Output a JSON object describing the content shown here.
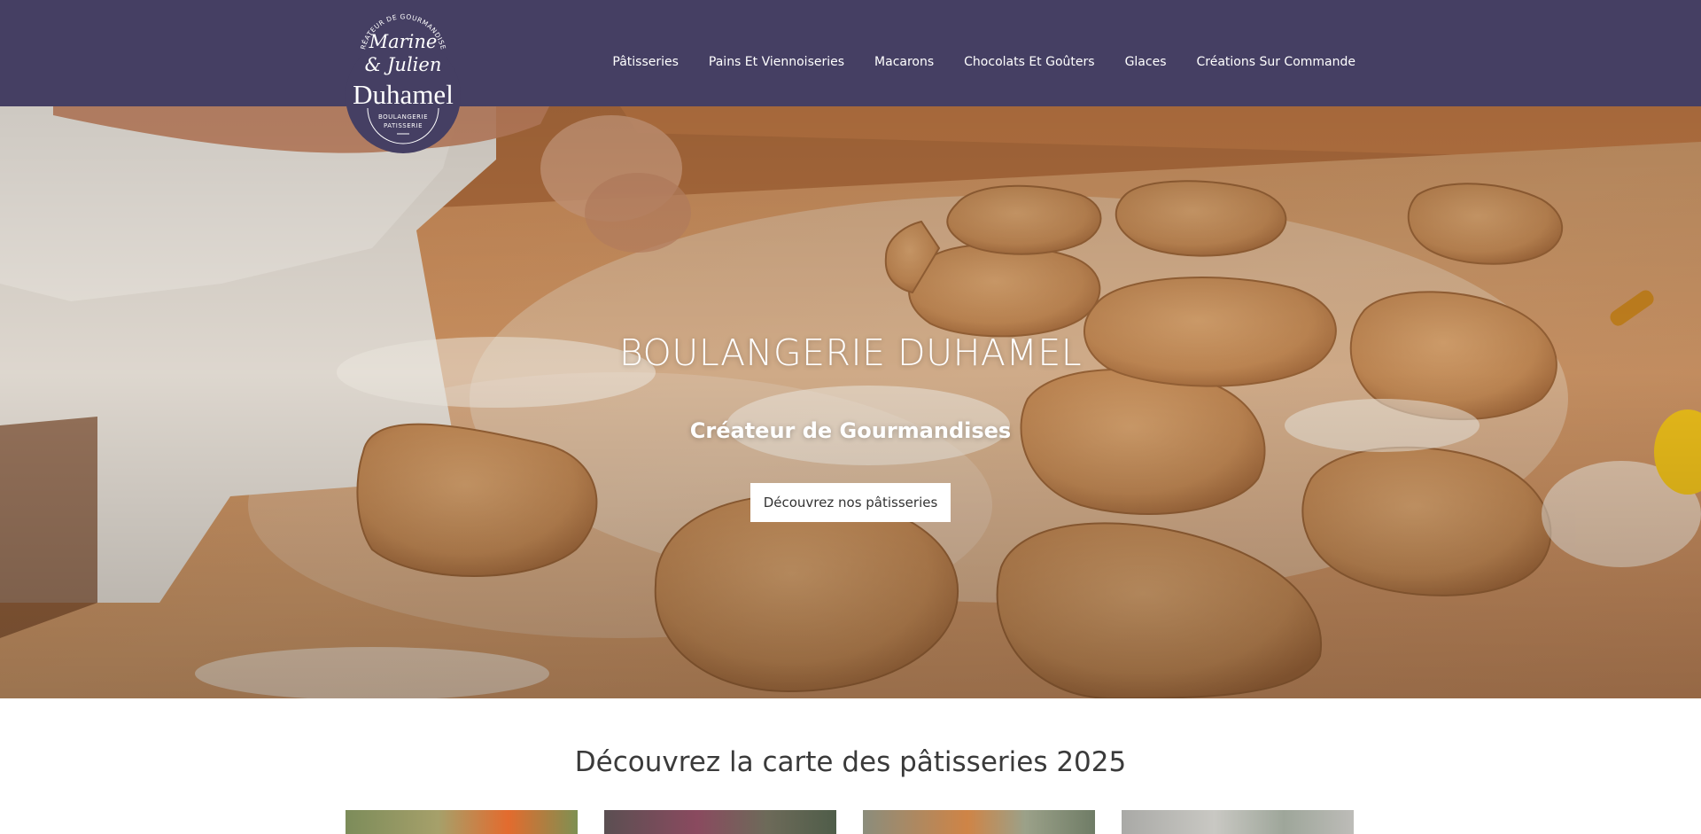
{
  "header": {
    "logo": {
      "top_text": "CRÉATEUR DE GOURMANDISES",
      "script_line1": "Marine",
      "script_line2": "& Julien",
      "name": "Duhamel",
      "bottom_line1": "BOULANGERIE",
      "bottom_line2": "PATISSERIE"
    },
    "nav": [
      {
        "label": "Pâtisseries"
      },
      {
        "label": "Pains Et Viennoiseries"
      },
      {
        "label": "Macarons"
      },
      {
        "label": "Chocolats Et Goûters"
      },
      {
        "label": "Glaces"
      },
      {
        "label": "Créations Sur Commande"
      }
    ]
  },
  "hero": {
    "title": "BOULANGERIE DUHAMEL",
    "subtitle": "Créateur de Gourmandises",
    "cta_label": "Découvrez nos pâtisseries"
  },
  "section": {
    "title": "Découvrez la carte des pâtisseries 2025"
  },
  "colors": {
    "header_bg": "#453f63",
    "logo_circle": "#453f63",
    "text_white": "#ffffff",
    "cta_bg": "#ffffff"
  }
}
